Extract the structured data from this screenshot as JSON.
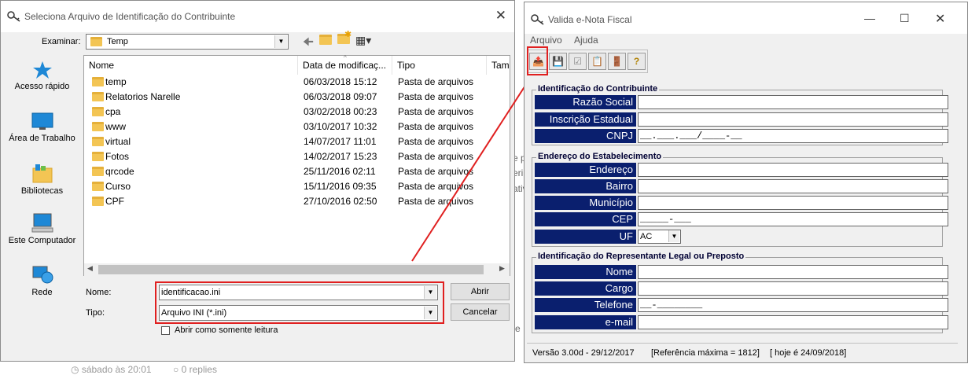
{
  "background": {
    "fragments": [
      "e p",
      "eri",
      "ativ",
      "e",
      "sábado às 20:01",
      "0 replies"
    ]
  },
  "file_dialog": {
    "title": "Seleciona Arquivo  de Identificação do Contribuinte",
    "look_in_label": "Examinar:",
    "look_in_value": "Temp",
    "places": [
      "Acesso rápido",
      "Área de Trabalho",
      "Bibliotecas",
      "Este Computador",
      "Rede"
    ],
    "columns": [
      "Nome",
      "Data de modificaç...",
      "Tipo",
      "Tam"
    ],
    "files": [
      {
        "name": "temp",
        "date": "06/03/2018 15:12",
        "type": "Pasta de arquivos"
      },
      {
        "name": "Relatorios Narelle",
        "date": "06/03/2018 09:07",
        "type": "Pasta de arquivos"
      },
      {
        "name": "cpa",
        "date": "03/02/2018 00:23",
        "type": "Pasta de arquivos"
      },
      {
        "name": "www",
        "date": "03/10/2017 10:32",
        "type": "Pasta de arquivos"
      },
      {
        "name": "virtual",
        "date": "14/07/2017 11:01",
        "type": "Pasta de arquivos"
      },
      {
        "name": "Fotos",
        "date": "14/02/2017 15:23",
        "type": "Pasta de arquivos"
      },
      {
        "name": "qrcode",
        "date": "25/11/2016 02:11",
        "type": "Pasta de arquivos"
      },
      {
        "name": "Curso",
        "date": "15/11/2016 09:35",
        "type": "Pasta de arquivos"
      },
      {
        "name": "CPF",
        "date": "27/10/2016 02:50",
        "type": "Pasta de arquivos"
      }
    ],
    "name_label": "Nome:",
    "name_value": "identificacao.ini",
    "type_label": "Tipo:",
    "type_value": "Arquivo INI (*.ini)",
    "open_button": "Abrir",
    "cancel_button": "Cancelar",
    "readonly_label": "Abrir como somente leitura"
  },
  "enota": {
    "title": "Valida e-Nota Fiscal",
    "menu": [
      "Arquivo",
      "Ajuda"
    ],
    "toolbar": [
      "open-file-icon",
      "save-icon",
      "check-icon",
      "export-icon",
      "exit-icon",
      "help-icon"
    ],
    "group1": {
      "title": "Identificação do Contribuinte",
      "fields": [
        {
          "label": "Razão Social",
          "value": ""
        },
        {
          "label": "Inscrição Estadual",
          "value": ""
        },
        {
          "label": "CNPJ",
          "value": "__.___.___/____-__"
        }
      ]
    },
    "group2": {
      "title": "Endereço do Estabelecimento",
      "fields": [
        {
          "label": "Endereço",
          "value": ""
        },
        {
          "label": "Bairro",
          "value": ""
        },
        {
          "label": "Município",
          "value": ""
        },
        {
          "label": "CEP",
          "value": "_____-___"
        }
      ],
      "uf_label": "UF",
      "uf_value": "AC"
    },
    "group3": {
      "title": "Identificação do Representante Legal ou Preposto",
      "fields": [
        {
          "label": "Nome",
          "value": ""
        },
        {
          "label": "Cargo",
          "value": ""
        },
        {
          "label": "Telefone",
          "value": "__-________"
        },
        {
          "label": "e-mail",
          "value": ""
        }
      ]
    },
    "status": {
      "version": "Versão 3.00d - 29/12/2017",
      "reference": "[Referência máxima = 1812]",
      "today": "[ hoje é 24/09/2018]"
    }
  }
}
